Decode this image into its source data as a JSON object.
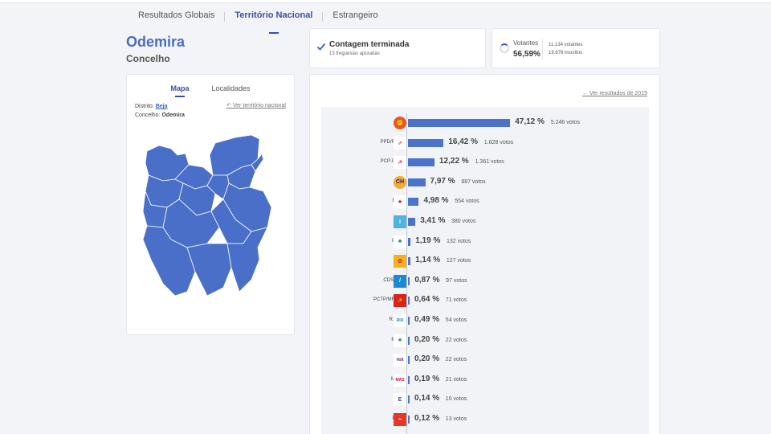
{
  "nav": {
    "tabs": [
      {
        "label": "Resultados Globais"
      },
      {
        "label": "Território Nacional"
      },
      {
        "label": "Estrangeiro"
      }
    ]
  },
  "header": {
    "title": "Odemira",
    "subtitle": "Concelho"
  },
  "map_panel": {
    "tabs": [
      {
        "label": "Mapa"
      },
      {
        "label": "Localidades"
      }
    ],
    "district_label": "Distrito:",
    "district_value": "Beja",
    "council_label": "Concelho:",
    "council_value": "Odemira",
    "national_link": "Ver território nacional",
    "colors": {
      "map_fill": "#4a6fc9",
      "map_stroke": "#ffffff"
    }
  },
  "status": {
    "title": "Contagem terminada",
    "subtitle": "13 freguesias apuradas"
  },
  "votes": {
    "label": "Votantes",
    "percent": "56,59%",
    "voters": "11.134 votantes",
    "registered": "19.676 inscritos"
  },
  "results": {
    "prev_link": "Ver resultados de 2019",
    "colors": {
      "bar": "#4a73c9",
      "accent": "#3a4fa0"
    },
    "parties": [
      {
        "name": "PS",
        "pct_value": 47.12,
        "pct": "47,12 %",
        "votes": "5.246 votos",
        "logo": "ps-rose-fist-icon"
      },
      {
        "name": "PPD/PSD",
        "pct_value": 16.42,
        "pct": "16,42 %",
        "votes": "1.828 votos",
        "logo": "psd-arrows-icon"
      },
      {
        "name": "PCP-PEV",
        "pct_value": 12.22,
        "pct": "12,22 %",
        "votes": "1.361 votos",
        "logo": "pcp-pev-hammer-sickle-icon"
      },
      {
        "name": "CH",
        "pct_value": 7.97,
        "pct": "7,97 %",
        "votes": "887 votos",
        "logo": "ch-logo-icon"
      },
      {
        "name": "B.E.",
        "pct_value": 4.98,
        "pct": "4,98 %",
        "votes": "554 votos",
        "logo": "be-star-icon"
      },
      {
        "name": "IL",
        "pct_value": 3.41,
        "pct": "3,41 %",
        "votes": "380 votos",
        "logo": "il-logo-icon"
      },
      {
        "name": "PAN",
        "pct_value": 1.19,
        "pct": "1,19 %",
        "votes": "132 votos",
        "logo": "pan-tree-icon"
      },
      {
        "name": "L",
        "pct_value": 1.14,
        "pct": "1,14 %",
        "votes": "127 votos",
        "logo": "livre-flower-icon"
      },
      {
        "name": "CDS-PP",
        "pct_value": 0.87,
        "pct": "0,87 %",
        "votes": "97 votos",
        "logo": "cds-pp-logo-icon"
      },
      {
        "name": "PCTP/MRPP",
        "pct_value": 0.64,
        "pct": "0,64 %",
        "votes": "71 votos",
        "logo": "pctp-mrpp-flag-icon"
      },
      {
        "name": "R.I.R.",
        "pct_value": 0.49,
        "pct": "0,49 %",
        "votes": "54 votos",
        "logo": "rir-logo-icon"
      },
      {
        "name": "MPT",
        "pct_value": 0.2,
        "pct": "0,20 %",
        "votes": "22 votos",
        "logo": "mpt-clover-icon"
      },
      {
        "name": "VP",
        "pct_value": 0.2,
        "pct": "0,20 %",
        "votes": "22 votos",
        "logo": "volt-logo-icon"
      },
      {
        "name": "MAS",
        "pct_value": 0.19,
        "pct": "0,19 %",
        "votes": "21 votos",
        "logo": "mas-logo-icon"
      },
      {
        "name": "E",
        "pct_value": 0.14,
        "pct": "0,14 %",
        "votes": "16 votos",
        "logo": "ergue-te-logo-icon"
      },
      {
        "name": "PTP",
        "pct_value": 0.12,
        "pct": "0,12 %",
        "votes": "13 votos",
        "logo": "ptp-logo-icon"
      }
    ]
  }
}
